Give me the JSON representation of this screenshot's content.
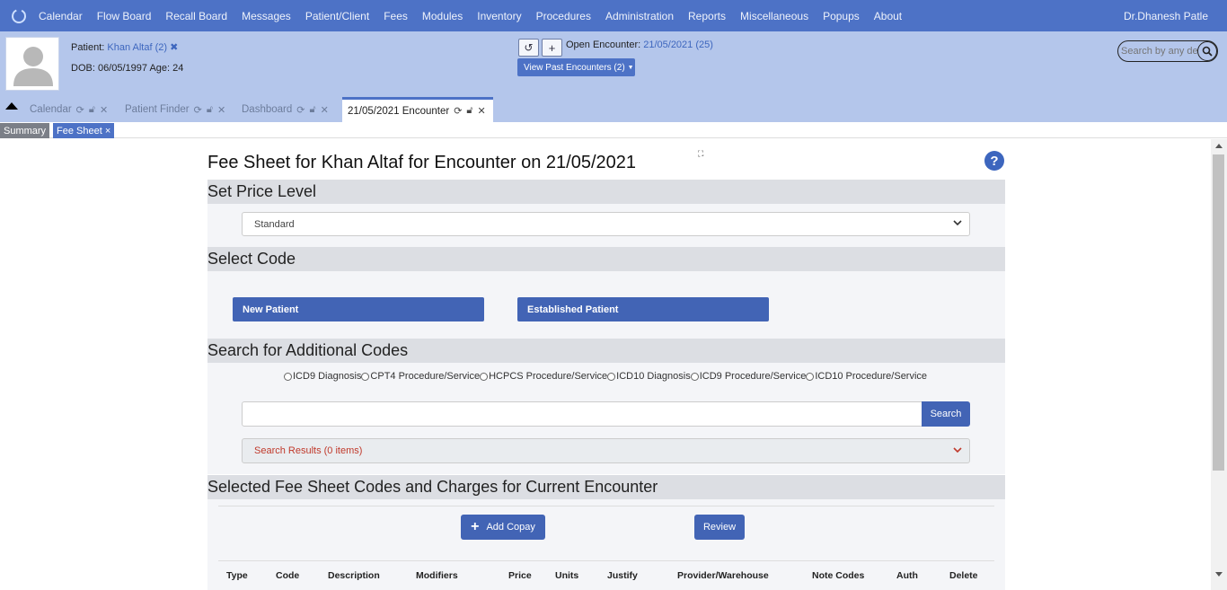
{
  "topnav": {
    "menu": [
      "Calendar",
      "Flow Board",
      "Recall Board",
      "Messages",
      "Patient/Client",
      "Fees",
      "Modules",
      "Inventory",
      "Procedures",
      "Administration",
      "Reports",
      "Miscellaneous",
      "Popups",
      "About"
    ],
    "user": "Dr.Dhanesh Patle"
  },
  "patient": {
    "label": "Patient:",
    "name": "Khan Altaf (2)",
    "dob_line": "DOB: 06/05/1997 Age: 24"
  },
  "encounter": {
    "open_label": "Open Encounter:",
    "open_value": "21/05/2021 (25)",
    "past_label": "View Past Encounters  (2)"
  },
  "search": {
    "placeholder": "Search by any demographics"
  },
  "tabs": [
    {
      "label": "Calendar"
    },
    {
      "label": "Patient Finder"
    },
    {
      "label": "Dashboard"
    },
    {
      "label": "21/05/2021 Encounter"
    }
  ],
  "subtabs": [
    {
      "label": "Summary"
    },
    {
      "label": "Fee Sheet ×"
    }
  ],
  "feesheet": {
    "title": "Fee Sheet for Khan Altaf for Encounter on 21/05/2021",
    "price_level_heading": "Set Price Level",
    "price_level_value": "Standard",
    "select_code_heading": "Select Code",
    "new_patient": "New Patient",
    "established_patient": "Established Patient",
    "additional_heading": "Search for Additional Codes",
    "code_types": [
      "ICD9 Diagnosis",
      "CPT4 Procedure/Service",
      "HCPCS Procedure/Service",
      "ICD10 Diagnosis",
      "ICD9 Procedure/Service",
      "ICD10 Procedure/Service"
    ],
    "search_button": "Search",
    "results": "Search Results (0 items)",
    "selected_heading": "Selected Fee Sheet Codes and Charges for Current Encounter",
    "add_copay": "Add Copay",
    "review": "Review",
    "columns": [
      "Type",
      "Code",
      "Description",
      "Modifiers",
      "Price",
      "Units",
      "Justify",
      "Provider/Warehouse",
      "Note Codes",
      "Auth",
      "Delete"
    ]
  },
  "colors": {
    "nav": "#4d72c6",
    "header": "#b4c6eb",
    "button": "#4264b5",
    "section_head": "#dcdee3"
  }
}
